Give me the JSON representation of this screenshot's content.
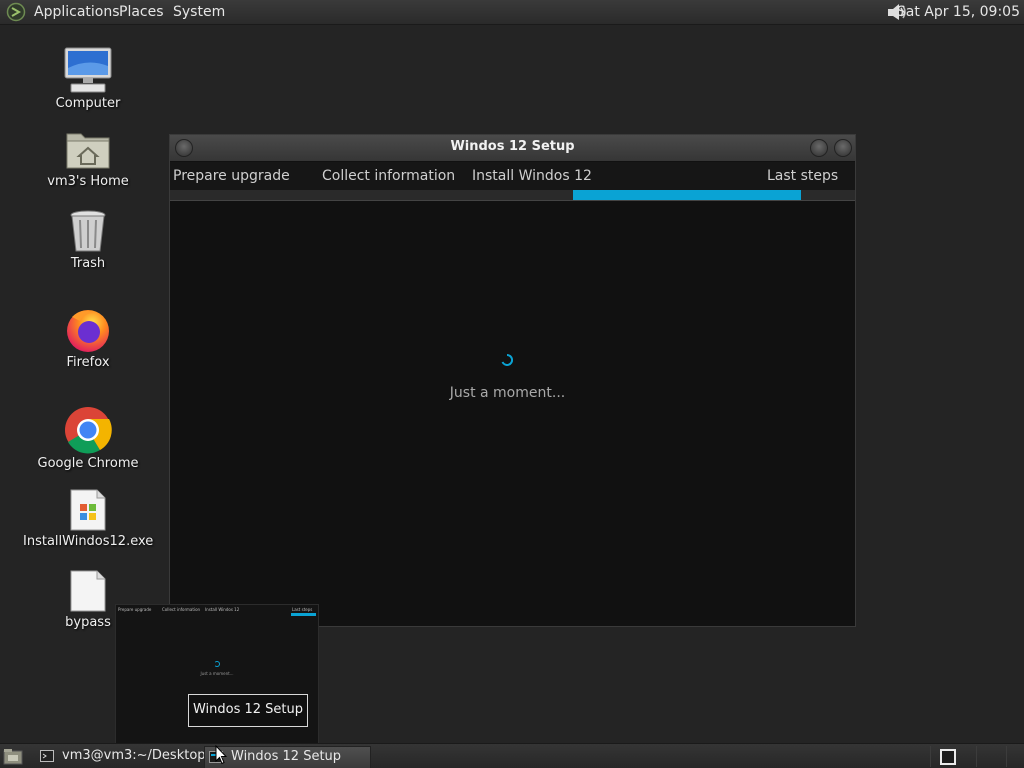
{
  "top_panel": {
    "menus": [
      "Applications",
      "Places",
      "System"
    ],
    "clock": "Sat Apr 15, 09:05"
  },
  "desktop_icons": [
    {
      "label": "Computer",
      "icon": "computer-icon"
    },
    {
      "label": "vm3's Home",
      "icon": "home-folder-icon"
    },
    {
      "label": "Trash",
      "icon": "trash-icon"
    },
    {
      "label": "Firefox",
      "icon": "firefox-icon"
    },
    {
      "label": "Google Chrome",
      "icon": "chrome-icon"
    },
    {
      "label": "InstallWindos12.exe",
      "icon": "exe-file-icon"
    },
    {
      "label": "bypass",
      "icon": "file-icon"
    }
  ],
  "setup_window": {
    "title": "Windos 12 Setup",
    "steps": [
      "Prepare upgrade",
      "Collect information",
      "Install Windos 12",
      "Last steps"
    ],
    "status": "Just a moment...",
    "accent_color": "#0aa3d4"
  },
  "preview": {
    "steps": [
      "Prepare upgrade",
      "Collect information",
      "Install Windos 12",
      "Last steps"
    ],
    "status": "Just a moment...",
    "tooltip": "Windos 12 Setup"
  },
  "taskbar": {
    "tasks": [
      {
        "label": "vm3@vm3:~/Desktop",
        "icon": "terminal-icon"
      },
      {
        "label": "Windos 12 Setup",
        "icon": "setup-window-icon"
      }
    ]
  }
}
